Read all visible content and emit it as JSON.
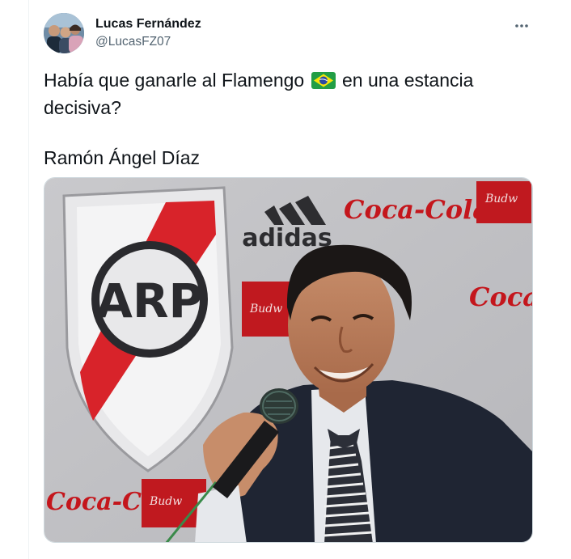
{
  "author": {
    "display_name": "Lucas Fernández",
    "handle": "@LucasFZ07"
  },
  "menu": {
    "icon": "more-horizontal-icon"
  },
  "tweet": {
    "line1_before_flag": "Había que ganarle al Flamengo",
    "flag_icon": "brazil-flag-emoji",
    "line1_after_flag": "en una estancia",
    "line2": "decisiva?",
    "line3": "Ramón Ángel Díaz"
  },
  "media": {
    "description_icon": "press-conference-photo",
    "visible_logos": {
      "club_crest_letters": "CARP",
      "sponsor_adidas": "adidas",
      "sponsor_coca_cola": "Coca-Cola",
      "sponsor_budweiser": "Budweiser"
    }
  },
  "colors": {
    "text_primary": "#0f1419",
    "text_secondary": "#536471",
    "border": "#cfd9de",
    "crest_red": "#d8232a",
    "suit": "#1f2533"
  }
}
